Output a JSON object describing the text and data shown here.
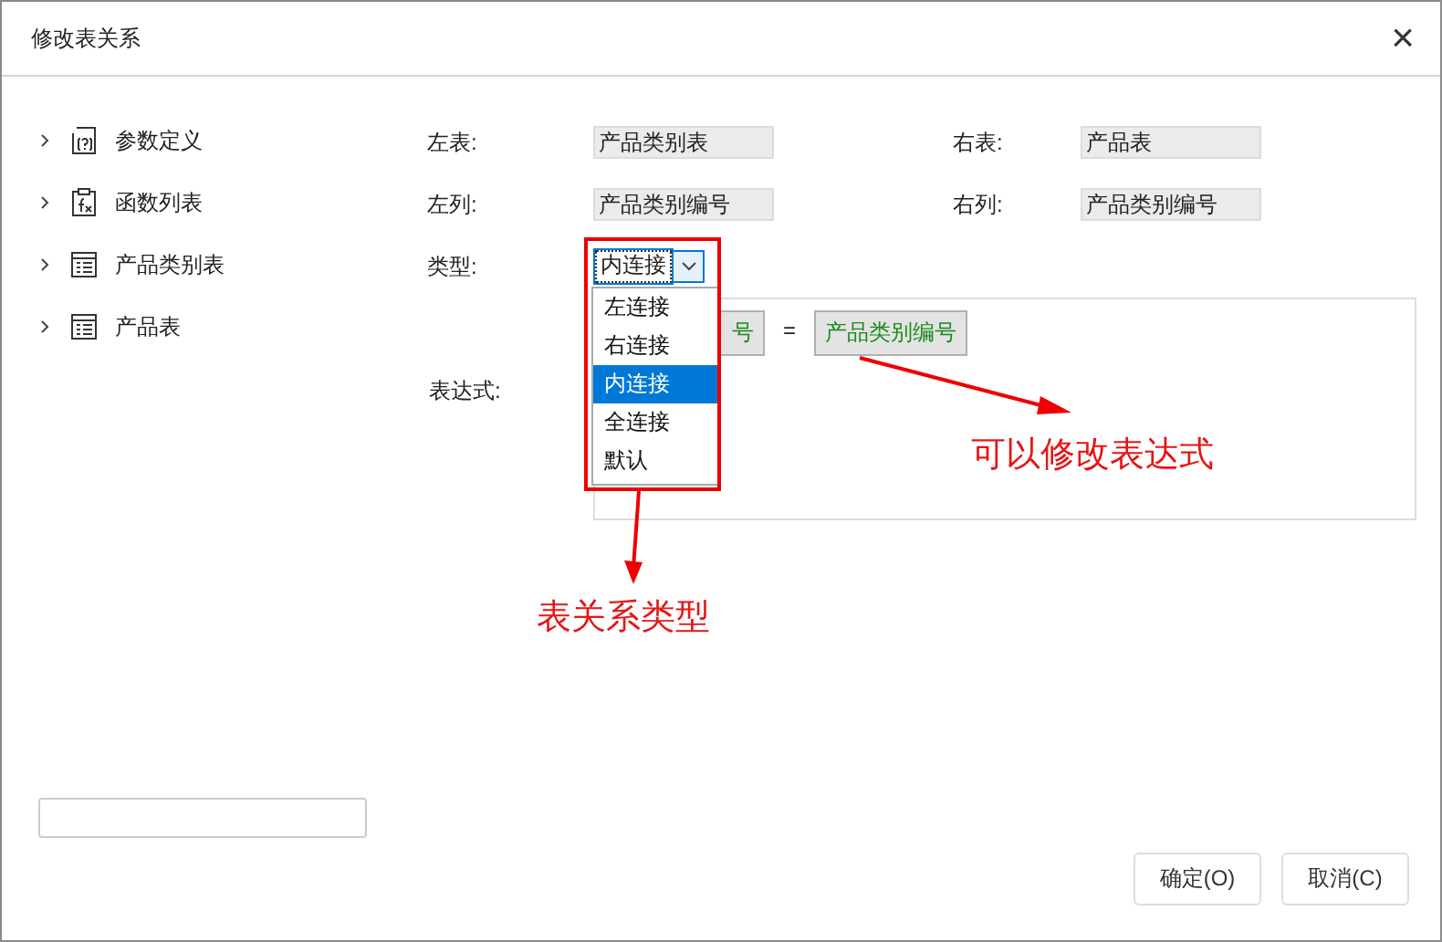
{
  "window": {
    "title": "修改表关系",
    "close": "×"
  },
  "tree": [
    {
      "label": "参数定义",
      "kind": "param",
      "expanded": false
    },
    {
      "label": "函数列表",
      "kind": "function",
      "expanded": false
    },
    {
      "label": "产品类别表",
      "kind": "table",
      "expanded": false
    },
    {
      "label": "产品表",
      "kind": "table",
      "expanded": false
    }
  ],
  "form": {
    "left_table": {
      "label": "左表:",
      "value": "产品类别表"
    },
    "right_table": {
      "label": "右表:",
      "value": "产品表"
    },
    "left_column": {
      "label": "左列:",
      "value": "产品类别编号"
    },
    "right_column": {
      "label": "右列:",
      "value": "产品类别编号"
    },
    "type": {
      "label": "类型:",
      "value": "内连接",
      "options": [
        {
          "label": "左连接",
          "selected": false
        },
        {
          "label": "右连接",
          "selected": false
        },
        {
          "label": "内连接",
          "selected": true
        },
        {
          "label": "全连接",
          "selected": false
        },
        {
          "label": "默认",
          "selected": false
        }
      ]
    },
    "expression": {
      "label": "表达式:",
      "left_token": "号",
      "operator": "=",
      "right_token": "产品类别编号"
    }
  },
  "annotations": [
    {
      "text": "表关系类型"
    },
    {
      "text": "可以修改表达式"
    }
  ],
  "buttons": [
    "确定(O)",
    "取消(C)"
  ]
}
